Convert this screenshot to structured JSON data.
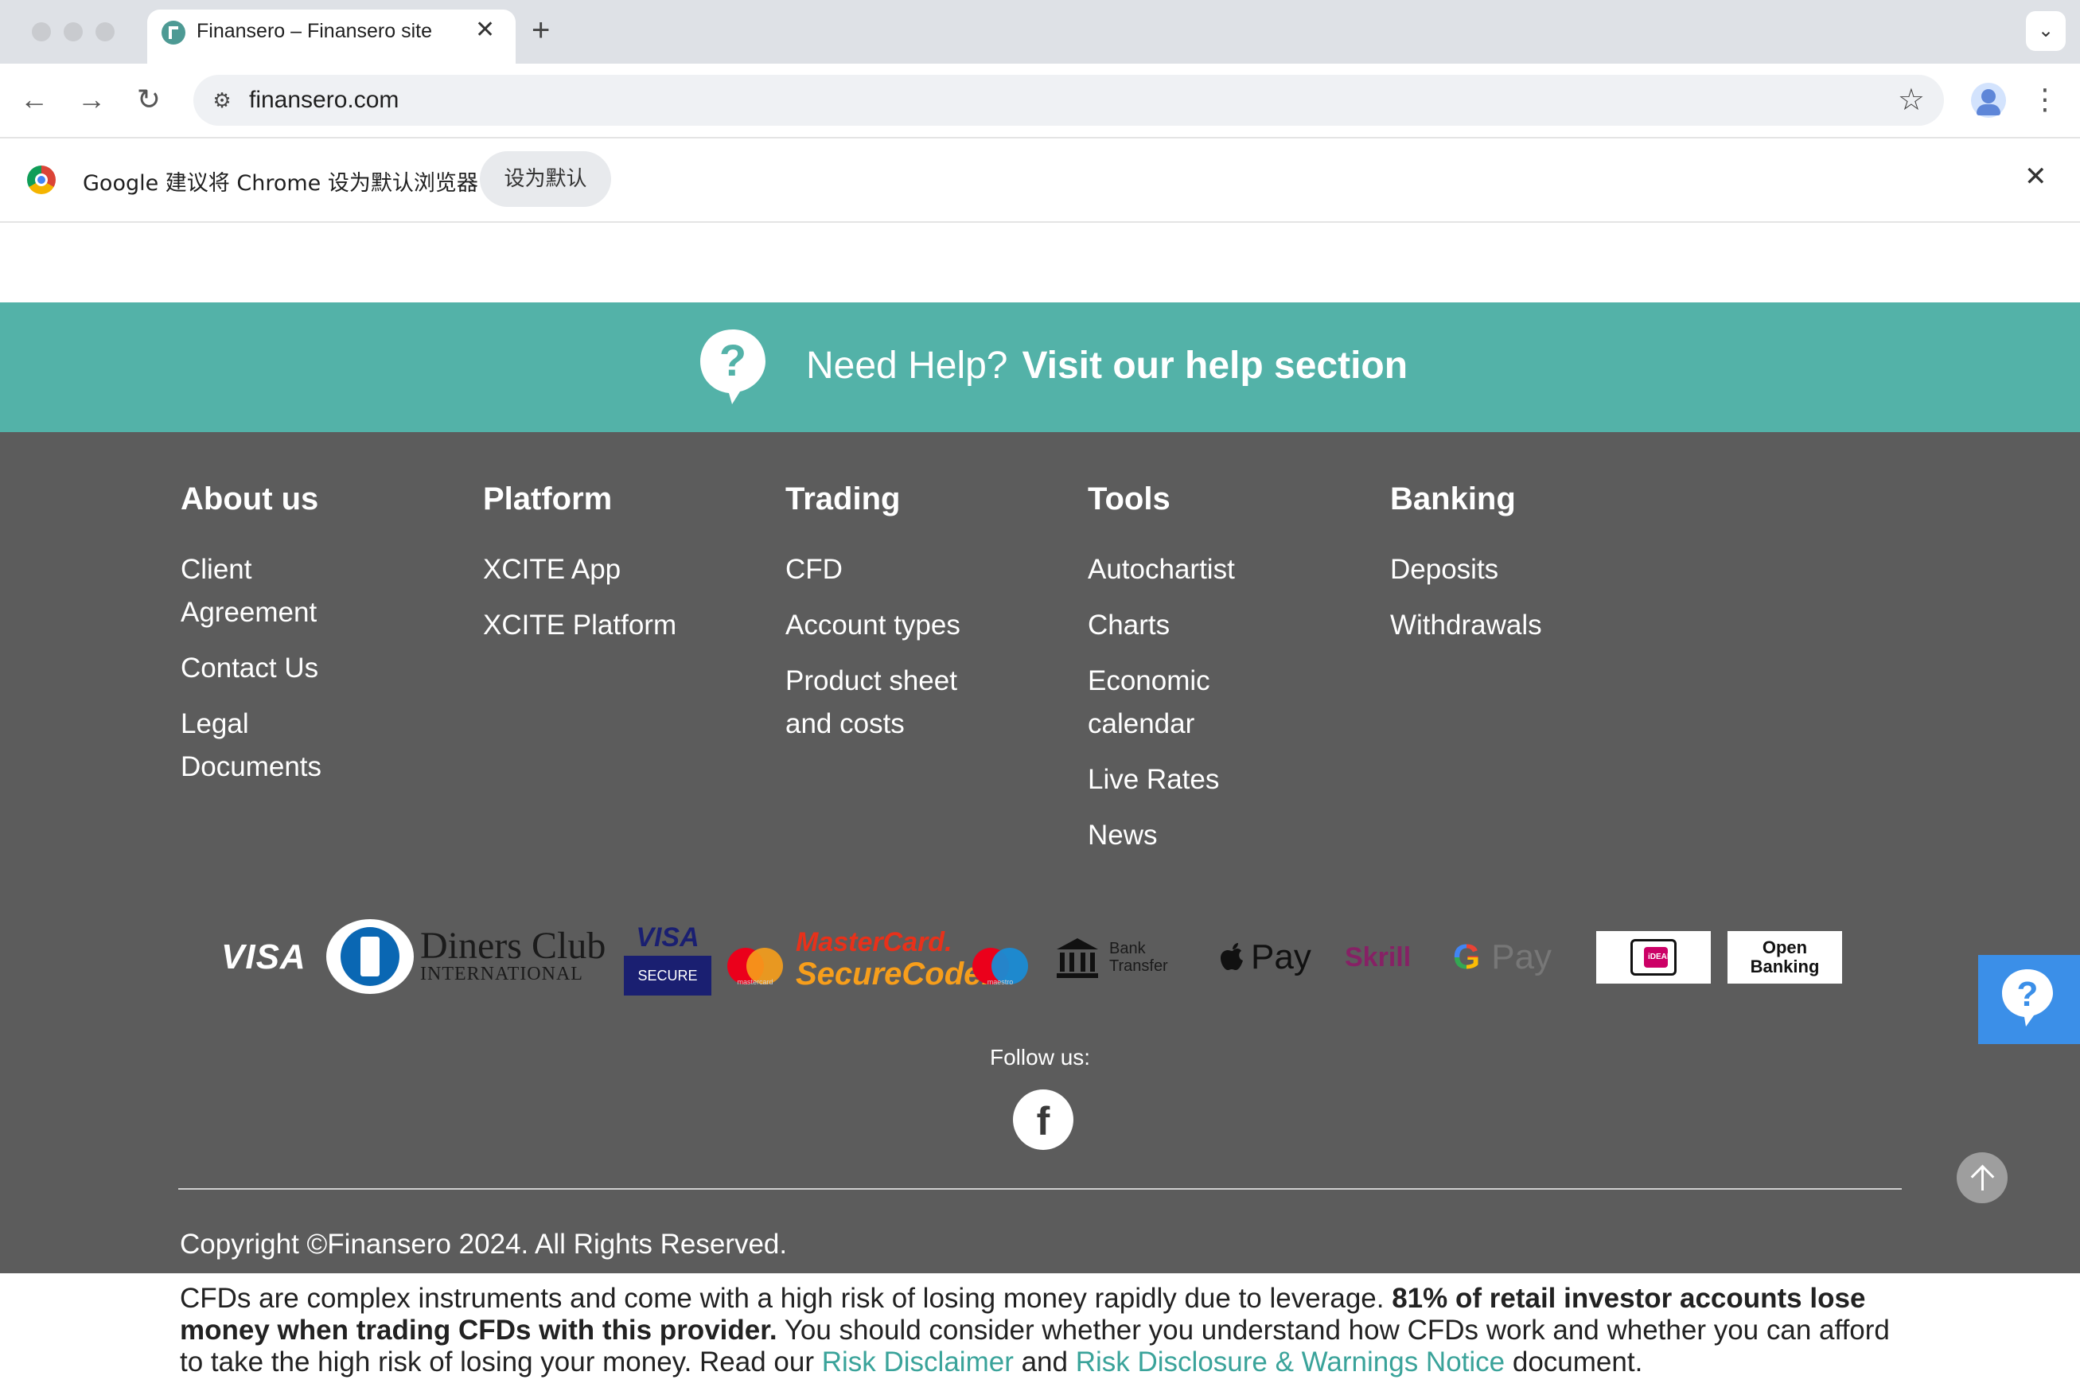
{
  "browser": {
    "tab_title": "Finansero – Finansero site",
    "tab_close": "✕",
    "new_tab": "+",
    "tab_menu": "⌄",
    "url": "finansero.com",
    "back": "←",
    "forward": "→",
    "reload": "↻",
    "site_info": "⚙",
    "star": "☆",
    "kebab": "⋮"
  },
  "infobar": {
    "message": "Google 建议将 Chrome 设为默认浏览器",
    "button": "设为默认",
    "close": "✕"
  },
  "help_banner": {
    "lead": "Need Help?",
    "link": "Visit our help section"
  },
  "footer": {
    "columns": [
      {
        "title": "About us",
        "items": [
          "Client Agreement",
          "Contact Us",
          "Legal Documents"
        ]
      },
      {
        "title": "Platform",
        "items": [
          "XCITE App",
          "XCITE Platform"
        ]
      },
      {
        "title": "Trading",
        "items": [
          "CFD",
          "Account types",
          "Product sheet and costs"
        ]
      },
      {
        "title": "Tools",
        "items": [
          "Autochartist",
          "Charts",
          "Economic calendar",
          "Live Rates",
          "News"
        ]
      },
      {
        "title": "Banking",
        "items": [
          "Deposits",
          "Withdrawals"
        ]
      }
    ],
    "payments": {
      "visa": "VISA",
      "diners_main": "Diners Club",
      "diners_sub": "INTERNATIONAL",
      "visa_secure_top": "VISA",
      "visa_secure_bottom": "SECURE",
      "mastercard_label": "mastercard",
      "securecode_top": "MasterCard.",
      "securecode_bottom": "SecureCode.",
      "maestro_label": "maestro",
      "bank_transfer_1": "Bank",
      "bank_transfer_2": "Transfer",
      "apple_pay": "Pay",
      "skrill": "Skrill",
      "gpay_g": "G",
      "gpay_pay": "Pay",
      "ideal": "iDEAL",
      "open_banking_1": "Open",
      "open_banking_2": "Banking"
    },
    "follow_label": "Follow us:",
    "facebook": "f",
    "copyright": "Copyright ©Finansero 2024. All Rights Reserved."
  },
  "risk": {
    "part1": "CFDs are complex instruments and come with a high risk of losing money rapidly due to leverage. ",
    "bold": "81% of retail investor accounts lose money when trading CFDs with this provider.",
    "part2": " You should consider whether you understand how CFDs work and whether you can afford to take the high risk of losing your money. Read our ",
    "link1": "Risk Disclaimer",
    "and": " and ",
    "link2": "Risk Disclosure & Warnings Notice",
    "part3": " document."
  },
  "colors": {
    "banner": "#53b2a8",
    "footer_bg": "#5c5c5c",
    "link": "#3aa39a",
    "help_float": "#3b8fe8"
  }
}
